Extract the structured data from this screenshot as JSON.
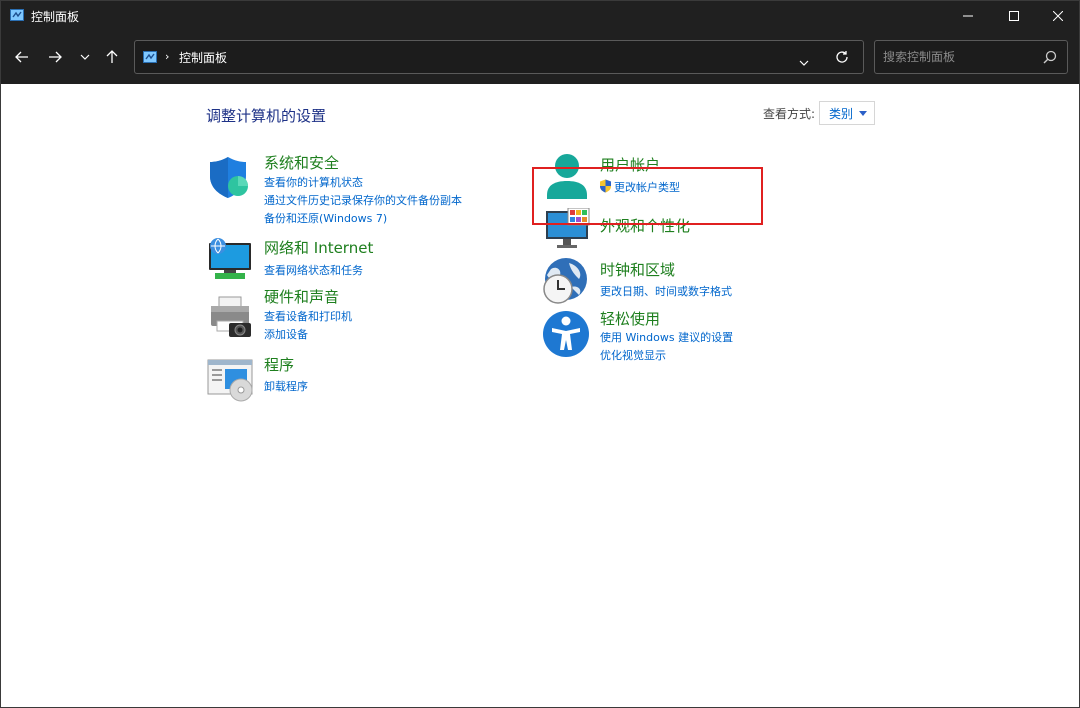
{
  "window": {
    "title": "控制面板"
  },
  "address": {
    "path": "控制面板"
  },
  "search": {
    "placeholder": "搜索控制面板"
  },
  "content": {
    "heading": "调整计算机的设置",
    "view_by_label": "查看方式:",
    "view_by_value": "类别"
  },
  "categories": {
    "system": {
      "title": "系统和安全",
      "links": [
        "查看你的计算机状态",
        "通过文件历史记录保存你的文件备份副本",
        "备份和还原(Windows 7)"
      ]
    },
    "network": {
      "title": "网络和 Internet",
      "links": [
        "查看网络状态和任务"
      ]
    },
    "hardware": {
      "title": "硬件和声音",
      "links": [
        "查看设备和打印机",
        "添加设备"
      ]
    },
    "programs": {
      "title": "程序",
      "links": [
        "卸载程序"
      ]
    },
    "users": {
      "title": "用户帐户",
      "links": [
        "更改帐户类型"
      ]
    },
    "appearance": {
      "title": "外观和个性化",
      "links": []
    },
    "clock": {
      "title": "时钟和区域",
      "links": [
        "更改日期、时间或数字格式"
      ]
    },
    "ease": {
      "title": "轻松使用",
      "links": [
        "使用 Windows 建议的设置",
        "优化视觉显示"
      ]
    }
  },
  "colors": {
    "category_title": "#1e7f1e",
    "link": "#0066cc",
    "heading": "#1e3287",
    "highlight": "#e02020",
    "titlebar": "#202020"
  },
  "icons": [
    "control-panel-icon",
    "minimize-icon",
    "maximize-icon",
    "close-icon",
    "back-arrow-icon",
    "forward-arrow-icon",
    "chevron-down-icon",
    "up-arrow-icon",
    "refresh-icon",
    "search-icon",
    "shield-icon",
    "globe-network-icon",
    "printer-icon",
    "programs-icon",
    "user-icon",
    "uac-shield-icon",
    "monitor-icon",
    "clock-globe-icon",
    "accessibility-icon"
  ]
}
